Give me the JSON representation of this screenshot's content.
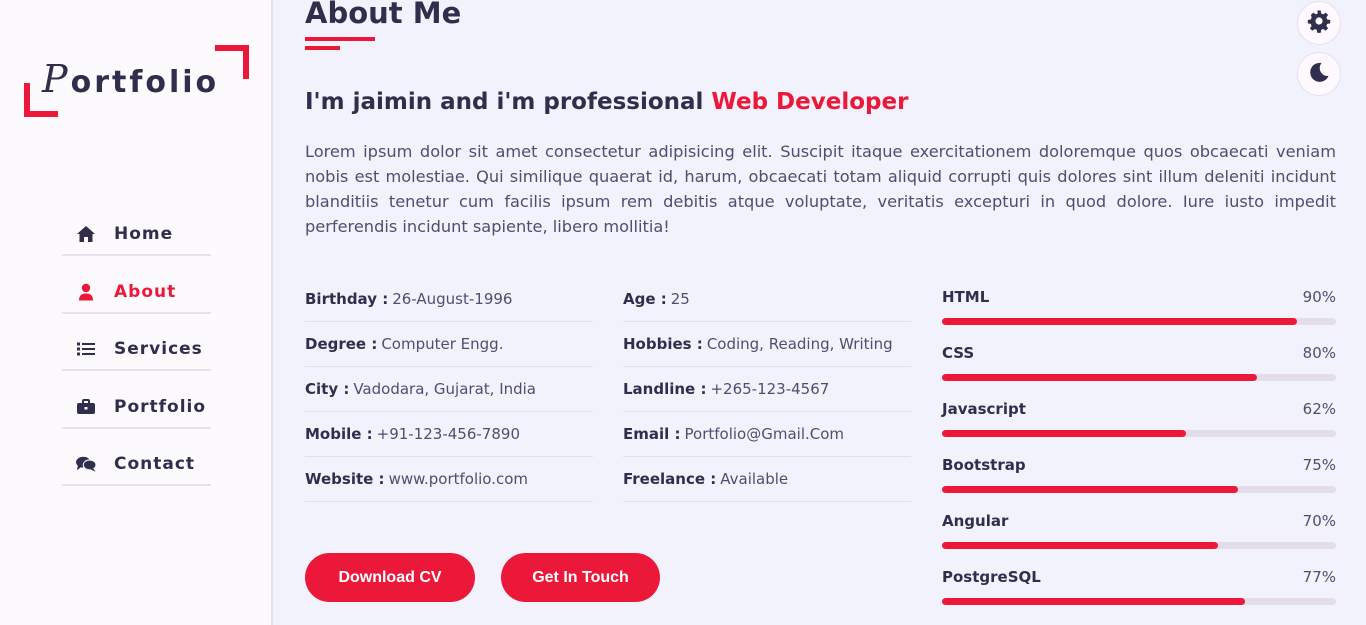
{
  "logo": {
    "first": "P",
    "rest": "ortfolio"
  },
  "nav": [
    {
      "label": "Home",
      "icon": "home-icon"
    },
    {
      "label": "About",
      "icon": "user-icon",
      "active": true
    },
    {
      "label": "Services",
      "icon": "list-icon"
    },
    {
      "label": "Portfolio",
      "icon": "briefcase-icon"
    },
    {
      "label": "Contact",
      "icon": "comments-icon"
    }
  ],
  "about": {
    "title": "About Me",
    "headline_prefix": "I'm jaimin and i'm professional ",
    "headline_accent": "Web Developer",
    "intro": "Lorem ipsum dolor sit amet consectetur adipisicing elit. Suscipit itaque exercitationem doloremque quos obcaecati veniam nobis est molestiae. Qui similique quaerat id, harum, obcaecati totam aliquid corrupti quis dolores sint illum deleniti incidunt blanditiis tenetur cum facilis ipsum rem debitis atque voluptate, veritatis excepturi in quod dolore. Iure iusto impedit perferendis incidunt sapiente, libero mollitia!"
  },
  "info_col1": [
    {
      "key": "Birthday :",
      "value": "26-August-1996"
    },
    {
      "key": "Degree :",
      "value": "Computer Engg."
    },
    {
      "key": "City :",
      "value": "Vadodara, Gujarat, India"
    },
    {
      "key": "Mobile :",
      "value": "+91-123-456-7890"
    },
    {
      "key": "Website :",
      "value": "www.portfolio.com"
    }
  ],
  "info_col2": [
    {
      "key": "Age :",
      "value": "25"
    },
    {
      "key": "Hobbies :",
      "value": "Coding, Reading, Writing"
    },
    {
      "key": "Landline :",
      "value": "+265-123-4567"
    },
    {
      "key": "Email :",
      "value": "Portfolio@Gmail.Com"
    },
    {
      "key": "Freelance :",
      "value": "Available"
    }
  ],
  "skills": [
    {
      "name": "HTML",
      "pct": "90%",
      "level": 0.9
    },
    {
      "name": "CSS",
      "pct": "80%",
      "level": 0.8
    },
    {
      "name": "Javascript",
      "pct": "62%",
      "level": 0.62
    },
    {
      "name": "Bootstrap",
      "pct": "75%",
      "level": 0.75
    },
    {
      "name": "Angular",
      "pct": "70%",
      "level": 0.7
    },
    {
      "name": "PostgreSQL",
      "pct": "77%",
      "level": 0.77
    }
  ],
  "buttons": {
    "download": "Download CV",
    "touch": "Get In Touch"
  },
  "switchers": {
    "settings_icon": "gear-icon",
    "theme_icon": "moon-icon"
  },
  "colors": {
    "accent": "#ec1839",
    "text": "#302e4d",
    "background": "#f1f2fb"
  }
}
